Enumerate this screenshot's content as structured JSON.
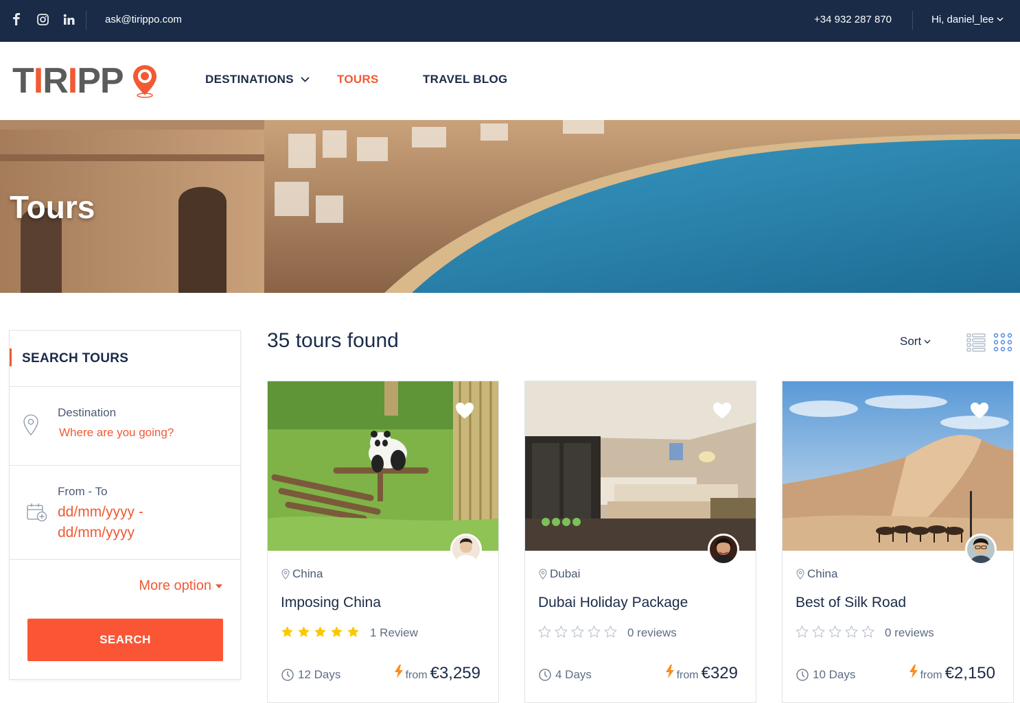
{
  "topbar": {
    "social": [
      "facebook-icon",
      "instagram-icon",
      "linkedin-icon"
    ],
    "email": "ask@tirippo.com",
    "phone": "+34 932 287 870",
    "user_greeting": "Hi, daniel_lee"
  },
  "header": {
    "logo_text": "TIRIPPO",
    "nav": {
      "destinations": "DESTINATIONS",
      "tours": "TOURS",
      "travel_blog": "TRAVEL BLOG"
    }
  },
  "hero": {
    "title": "Tours"
  },
  "sidebar": {
    "heading": "SEARCH TOURS",
    "destination_label": "Destination",
    "destination_placeholder": "Where are you going?",
    "date_label": "From - To",
    "date_placeholder": "dd/mm/yyyy - dd/mm/yyyy",
    "more_option": "More option",
    "search_button": "SEARCH"
  },
  "results": {
    "count_text": "35 tours found",
    "sort_label": "Sort"
  },
  "tours": [
    {
      "location": "China",
      "title": "Imposing China",
      "rating": 5,
      "reviews": "1 Review",
      "duration": "12 Days",
      "from": "from",
      "price": "€3,259"
    },
    {
      "location": "Dubai",
      "title": "Dubai Holiday Package",
      "rating": 0,
      "reviews": "0 reviews",
      "duration": "4 Days",
      "from": "from",
      "price": "€329"
    },
    {
      "location": "China",
      "title": "Best of Silk Road",
      "rating": 0,
      "reviews": "0 reviews",
      "duration": "10 Days",
      "from": "from",
      "price": "€2,150"
    }
  ],
  "colors": {
    "navy": "#1a2b48",
    "accent": "#f05a34",
    "button": "#fa5636",
    "star": "#fac800"
  }
}
